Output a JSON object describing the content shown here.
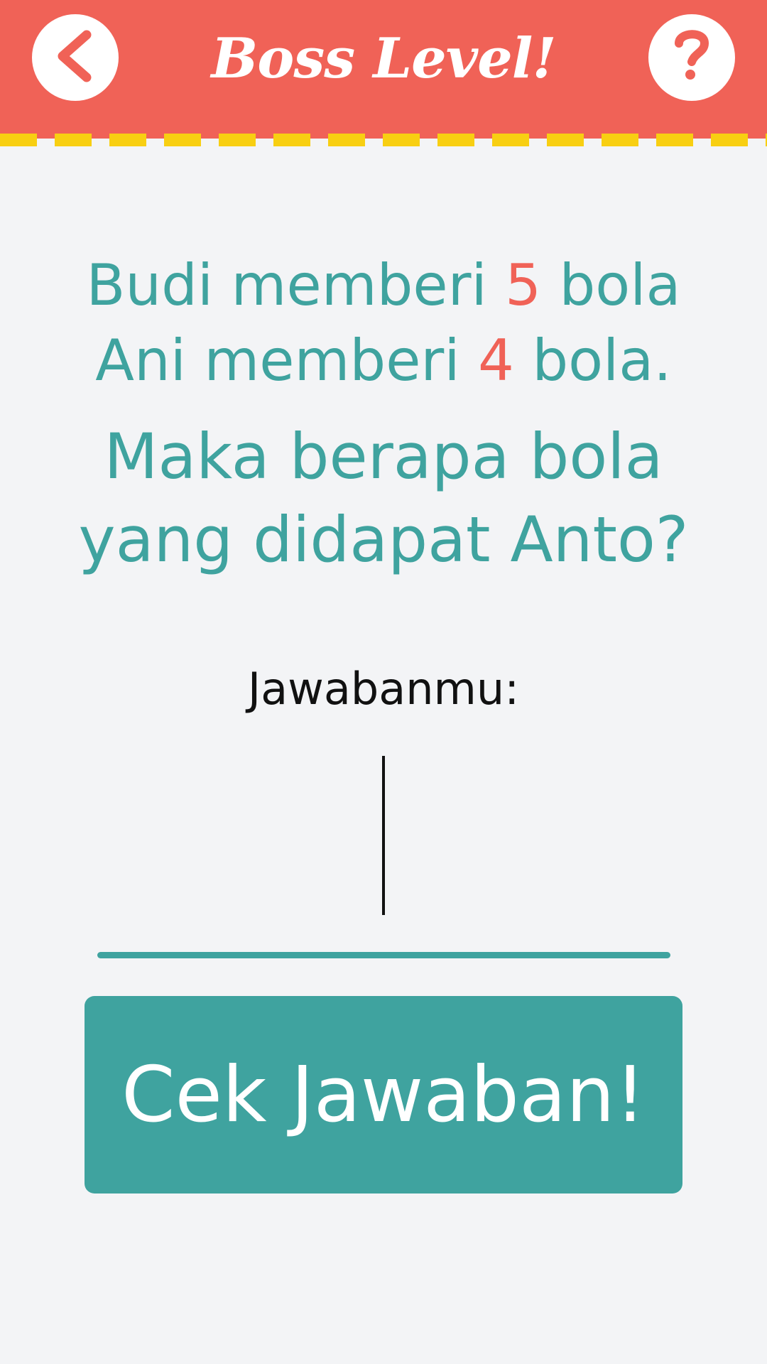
{
  "header": {
    "title": "Boss Level!",
    "back_icon": "chevron-left-icon",
    "help_icon": "question-mark-icon"
  },
  "question": {
    "line1": {
      "before": "Budi memberi ",
      "number": "5",
      "after": " bola"
    },
    "line2": {
      "before": "Ani memberi ",
      "number": "4",
      "after": " bola."
    },
    "line3": "Maka berapa bola",
    "line4": "yang didapat Anto?"
  },
  "answer": {
    "label": "Jawabanmu:",
    "value": "",
    "placeholder": ""
  },
  "submit": {
    "label": "Cek Jawaban!"
  },
  "colors": {
    "header": "#f06257",
    "dash": "#f8cf12",
    "teal": "#3fa39f",
    "number_accent": "#f06257",
    "background": "#f3f4f6"
  }
}
